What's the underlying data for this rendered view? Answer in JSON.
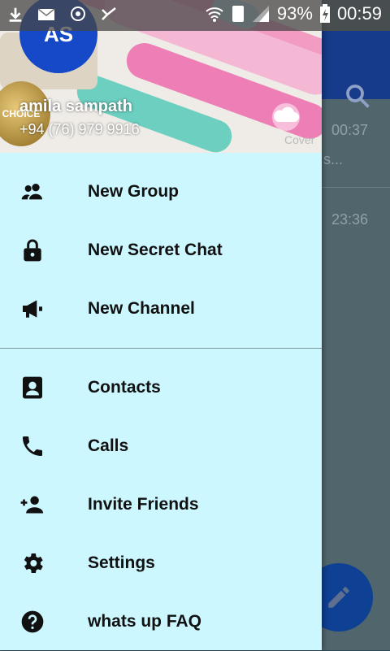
{
  "status_bar": {
    "battery": "93%",
    "time": "00:59"
  },
  "background_chat": {
    "rows": [
      {
        "time": "00:37",
        "snippet": "s..."
      },
      {
        "time": "23:36"
      }
    ]
  },
  "header": {
    "avatar_initials": "AS",
    "user_name": "amila sampath",
    "phone": "+94 (76) 979 9916",
    "badge_text": "CHOICE",
    "cover_label": "Cover"
  },
  "menu": {
    "group1": [
      {
        "label": "New Group",
        "icon": "group-icon"
      },
      {
        "label": "New Secret Chat",
        "icon": "lock-icon"
      },
      {
        "label": "New Channel",
        "icon": "megaphone-icon"
      }
    ],
    "group2": [
      {
        "label": "Contacts",
        "icon": "contacts-icon"
      },
      {
        "label": "Calls",
        "icon": "phone-icon"
      },
      {
        "label": "Invite Friends",
        "icon": "add-person-icon"
      },
      {
        "label": "Settings",
        "icon": "gear-icon"
      },
      {
        "label": "whats up FAQ",
        "icon": "help-icon"
      }
    ]
  },
  "colors": {
    "drawer_bg": "#ccf7ff",
    "avatar": "#1549c8",
    "toolbar": "#163b8a",
    "fab": "#0e4093"
  }
}
